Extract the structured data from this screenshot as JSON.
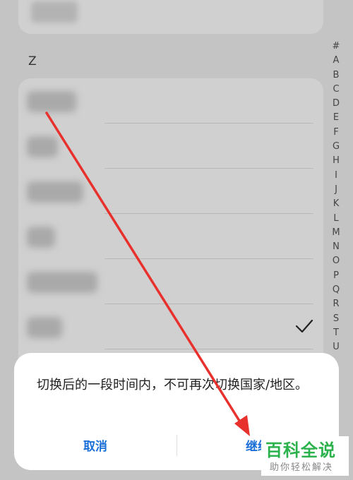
{
  "section": {
    "letter": "Z"
  },
  "alphabet_index": [
    "#",
    "A",
    "B",
    "C",
    "D",
    "E",
    "F",
    "G",
    "H",
    "I",
    "J",
    "K",
    "L",
    "M",
    "N",
    "O",
    "P",
    "Q",
    "R",
    "S",
    "T",
    "U"
  ],
  "dialog": {
    "message": "切换后的一段时间内，不可再次切换国家/地区。",
    "cancel_label": "取消",
    "continue_label": "继续"
  },
  "watermark": {
    "title": "百科全说",
    "subtitle": "助你轻松解决"
  },
  "icons": {
    "selected_row_mark": "check-icon",
    "annotation": "red-arrow"
  },
  "colors": {
    "accent": "#1a6fd8",
    "arrow": "#e8302c",
    "watermark": "#2bb24c"
  }
}
